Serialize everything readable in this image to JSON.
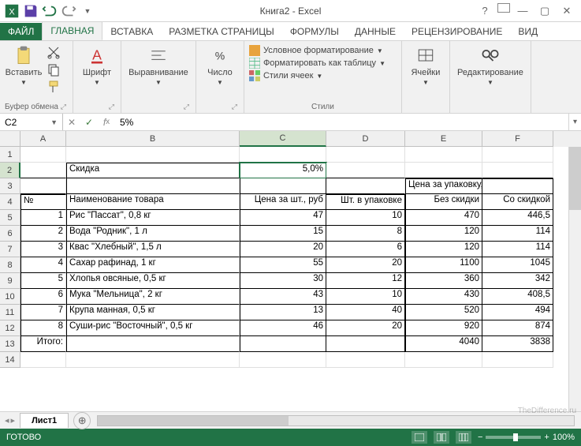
{
  "window": {
    "title": "Книга2 - Excel"
  },
  "tabs": {
    "file": "ФАЙЛ",
    "items": [
      "ГЛАВНАЯ",
      "ВСТАВКА",
      "РАЗМЕТКА СТРАНИЦЫ",
      "ФОРМУЛЫ",
      "ДАННЫЕ",
      "РЕЦЕНЗИРОВАНИЕ",
      "ВИД"
    ],
    "active": 0
  },
  "ribbon": {
    "clipboard": {
      "paste": "Вставить",
      "label": "Буфер обмена"
    },
    "font": {
      "btn": "Шрифт"
    },
    "align": {
      "btn": "Выравнивание"
    },
    "number": {
      "btn": "Число"
    },
    "styles": {
      "cond": "Условное форматирование",
      "table": "Форматировать как таблицу",
      "cell": "Стили ячеек",
      "label": "Стили"
    },
    "cells": {
      "btn": "Ячейки"
    },
    "editing": {
      "btn": "Редактирование"
    }
  },
  "namebox": "C2",
  "formula": "5%",
  "columns": [
    "A",
    "B",
    "C",
    "D",
    "E",
    "F"
  ],
  "sheet": {
    "r2": {
      "b": "Скидка",
      "c": "5,0%"
    },
    "r3": {
      "e": "Цена за упаковку, руб"
    },
    "r4": {
      "a": "№",
      "b": "Наименование товара",
      "c": "Цена за шт., руб",
      "d": "Шт. в упаковке",
      "e": "Без скидки",
      "f": "Со скидкой"
    },
    "r5": {
      "a": "1",
      "b": "Рис \"Пассат\", 0,8 кг",
      "c": "47",
      "d": "10",
      "e": "470",
      "f": "446,5"
    },
    "r6": {
      "a": "2",
      "b": "Вода \"Родник\", 1 л",
      "c": "15",
      "d": "8",
      "e": "120",
      "f": "114"
    },
    "r7": {
      "a": "3",
      "b": "Квас \"Хлебный\", 1,5 л",
      "c": "20",
      "d": "6",
      "e": "120",
      "f": "114"
    },
    "r8": {
      "a": "4",
      "b": "Сахар рафинад, 1 кг",
      "c": "55",
      "d": "20",
      "e": "1100",
      "f": "1045"
    },
    "r9": {
      "a": "5",
      "b": "Хлопья овсяные, 0,5 кг",
      "c": "30",
      "d": "12",
      "e": "360",
      "f": "342"
    },
    "r10": {
      "a": "6",
      "b": "Мука \"Мельница\", 2 кг",
      "c": "43",
      "d": "10",
      "e": "430",
      "f": "408,5"
    },
    "r11": {
      "a": "7",
      "b": "Крупа манная, 0,5 кг",
      "c": "13",
      "d": "40",
      "e": "520",
      "f": "494"
    },
    "r12": {
      "a": "8",
      "b": "Суши-рис \"Восточный\", 0,5 кг",
      "c": "46",
      "d": "20",
      "e": "920",
      "f": "874"
    },
    "r13": {
      "a": "Итого:",
      "e": "4040",
      "f": "3838"
    }
  },
  "sheettab": "Лист1",
  "status": {
    "ready": "ГОТОВО",
    "zoom": "100%"
  },
  "watermark": "TheDifference.ru"
}
